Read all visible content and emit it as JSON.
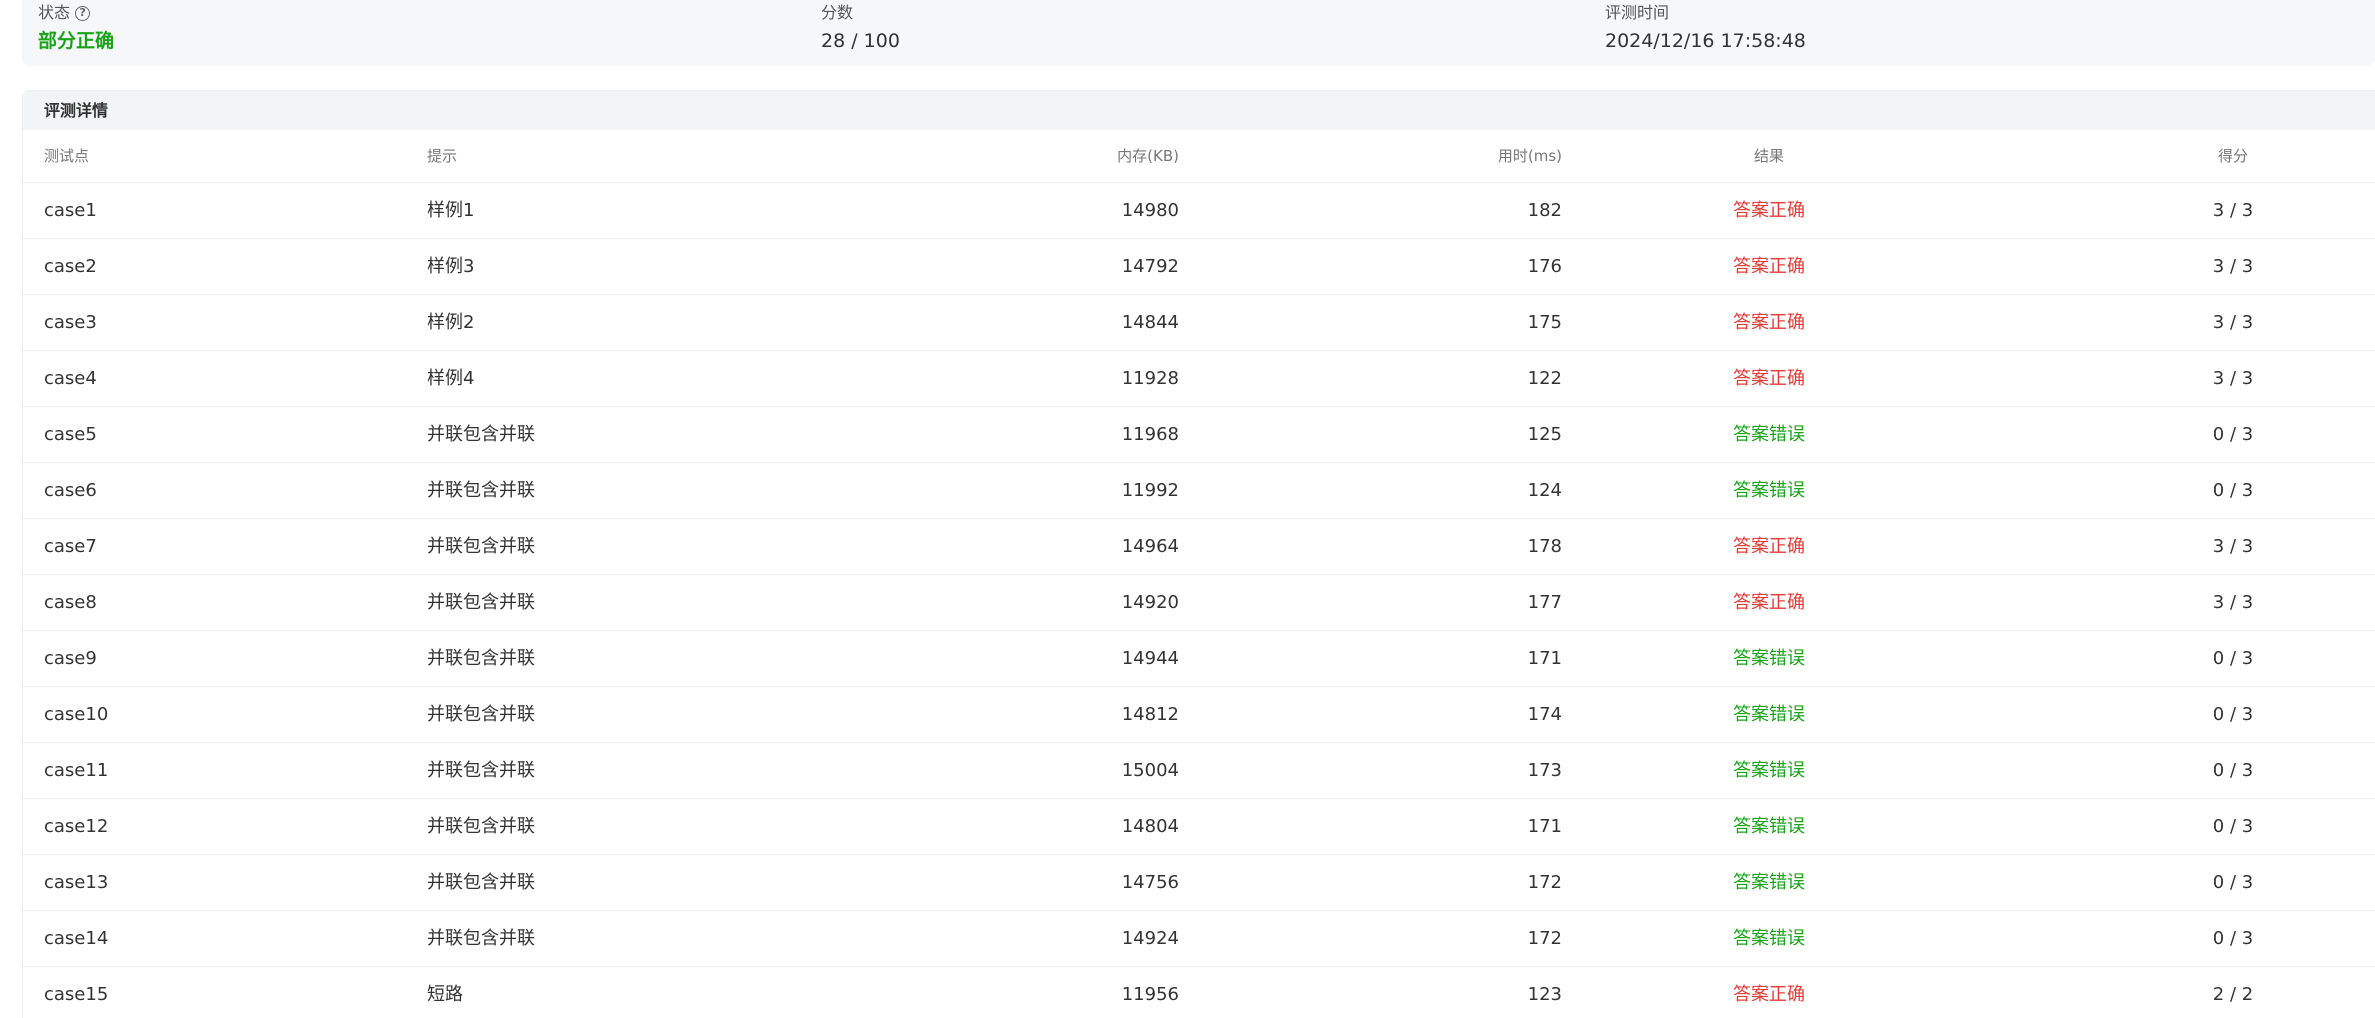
{
  "summary": {
    "status_label": "状态",
    "status_value": "部分正确",
    "score_label": "分数",
    "score_value": "28 / 100",
    "time_label": "评测时间",
    "time_value": "2024/12/16 17:58:48"
  },
  "details": {
    "title": "评测详情",
    "headers": {
      "case": "测试点",
      "hint": "提示",
      "memory": "内存(KB)",
      "time": "用时(ms)",
      "result": "结果",
      "score": "得分"
    },
    "rows": [
      {
        "case": "case1",
        "hint": "样例1",
        "memory": "14980",
        "time": "182",
        "result": "答案正确",
        "score": "3 / 3"
      },
      {
        "case": "case2",
        "hint": "样例3",
        "memory": "14792",
        "time": "176",
        "result": "答案正确",
        "score": "3 / 3"
      },
      {
        "case": "case3",
        "hint": "样例2",
        "memory": "14844",
        "time": "175",
        "result": "答案正确",
        "score": "3 / 3"
      },
      {
        "case": "case4",
        "hint": "样例4",
        "memory": "11928",
        "time": "122",
        "result": "答案正确",
        "score": "3 / 3"
      },
      {
        "case": "case5",
        "hint": "并联包含并联",
        "memory": "11968",
        "time": "125",
        "result": "答案错误",
        "score": "0 / 3"
      },
      {
        "case": "case6",
        "hint": "并联包含并联",
        "memory": "11992",
        "time": "124",
        "result": "答案错误",
        "score": "0 / 3"
      },
      {
        "case": "case7",
        "hint": "并联包含并联",
        "memory": "14964",
        "time": "178",
        "result": "答案正确",
        "score": "3 / 3"
      },
      {
        "case": "case8",
        "hint": "并联包含并联",
        "memory": "14920",
        "time": "177",
        "result": "答案正确",
        "score": "3 / 3"
      },
      {
        "case": "case9",
        "hint": "并联包含并联",
        "memory": "14944",
        "time": "171",
        "result": "答案错误",
        "score": "0 / 3"
      },
      {
        "case": "case10",
        "hint": "并联包含并联",
        "memory": "14812",
        "time": "174",
        "result": "答案错误",
        "score": "0 / 3"
      },
      {
        "case": "case11",
        "hint": "并联包含并联",
        "memory": "15004",
        "time": "173",
        "result": "答案错误",
        "score": "0 / 3"
      },
      {
        "case": "case12",
        "hint": "并联包含并联",
        "memory": "14804",
        "time": "171",
        "result": "答案错误",
        "score": "0 / 3"
      },
      {
        "case": "case13",
        "hint": "并联包含并联",
        "memory": "14756",
        "time": "172",
        "result": "答案错误",
        "score": "0 / 3"
      },
      {
        "case": "case14",
        "hint": "并联包含并联",
        "memory": "14924",
        "time": "172",
        "result": "答案错误",
        "score": "0 / 3"
      },
      {
        "case": "case15",
        "hint": "短路",
        "memory": "11956",
        "time": "123",
        "result": "答案正确",
        "score": "2 / 2"
      }
    ]
  },
  "colors": {
    "accepted": "#e53935",
    "wrong": "#1aa31a",
    "partial_status": "#1aa31a"
  }
}
